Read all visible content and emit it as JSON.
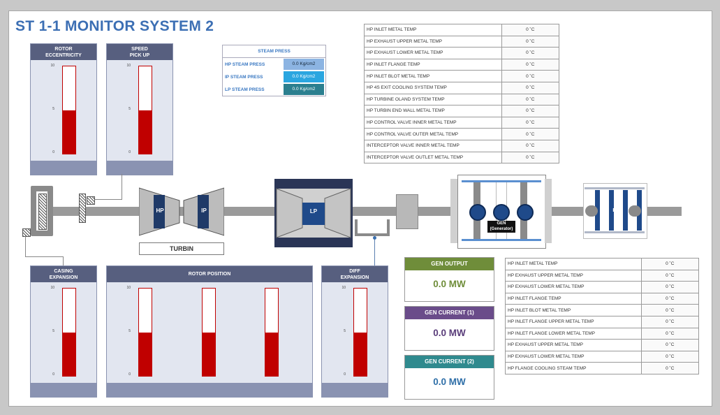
{
  "title": "ST 1-1 MONITOR SYSTEM 2",
  "colors": {
    "accent": "#3c6fb4",
    "panel_header": "#575f7f",
    "gauge_red": "#c00000",
    "gen_output": "#6f8d3a",
    "gen_current1": "#6a4c8a",
    "gen_current2": "#2f8a8e"
  },
  "gauges": {
    "rotor_eccentricity": {
      "title_line1": "ROTOR",
      "title_line2": "ECCENTRICITY",
      "ticks": [
        "10",
        "5",
        "0"
      ],
      "level": 0.5
    },
    "speed_pick_up": {
      "title_line1": "SPEED",
      "title_line2": "PICK UP",
      "ticks": [
        "10",
        "5",
        "0"
      ],
      "level": 0.5
    },
    "casing_expansion": {
      "title_line1": "CASING",
      "title_line2": "EXPANSION",
      "ticks": [
        "10",
        "5",
        "0"
      ],
      "level": 0.5
    },
    "rotor_position": {
      "title": "ROTOR POSITION",
      "ticks": [
        "10",
        "5",
        "0"
      ],
      "levels": [
        0.5,
        0.5,
        0.5
      ]
    },
    "diff_expansion": {
      "title_line1": "DIFF",
      "title_line2": "EXPANSION",
      "ticks": [
        "10",
        "5",
        "0"
      ],
      "level": 0.5
    }
  },
  "steam_press": {
    "title": "STEAM PRESS",
    "rows": [
      {
        "label": "HP STEAM PRESS",
        "value": "0.0 Kg/cm2",
        "color": "#8cb4e2"
      },
      {
        "label": "IP STEAM PRESS",
        "value": "0.0 Kg/cm2",
        "color": "#2aa6e0"
      },
      {
        "label": "LP STEAM PRESS",
        "value": "0.0 Kg/cm2",
        "color": "#2b7f8f"
      }
    ]
  },
  "temp_table_top": [
    {
      "label": "HP INLET METAL TEMP",
      "value": "0 ˚C"
    },
    {
      "label": "HP EXHAUST UPPER METAL TEMP",
      "value": "0 ˚C"
    },
    {
      "label": "HP EXHAUST LOWER METAL TEMP",
      "value": "0 ˚C"
    },
    {
      "label": "HP INLET FLANGE TEMP",
      "value": "0 ˚C"
    },
    {
      "label": "HP INLET BLOT METAL TEMP",
      "value": "0 ˚C"
    },
    {
      "label": "HP 4S EXIT COOLING SYSTEM TEMP",
      "value": "0 ˚C"
    },
    {
      "label": "HP TURBINE OLAND SYSTEM TEMP",
      "value": "0 ˚C"
    },
    {
      "label": "HP TURBIN END WALL METAL TEMP",
      "value": "0 ˚C"
    },
    {
      "label": " HP CONTROL VALVE INNER METAL TEMP",
      "value": "0 ˚C"
    },
    {
      "label": "HP CONTROL VALVE OUTER METAL TEMP",
      "value": "0 ˚C"
    },
    {
      "label": "INTERCEPTOR VALVE INNER METAL TEMP",
      "value": "0 ˚C"
    },
    {
      "label": "INTERCEPTOR VALVE OUTLET METAL TEMP",
      "value": "0 ˚C"
    }
  ],
  "temp_table_bottom": [
    {
      "label": "HP INLET METAL TEMP",
      "value": "0 ˚C"
    },
    {
      "label": "HP EXHAUST UPPER METAL TEMP",
      "value": "0 ˚C"
    },
    {
      "label": "HP EXHAUST LOWER METAL TEMP",
      "value": "0 ˚C"
    },
    {
      "label": "HP INLET FLANGE TEMP",
      "value": "0 ˚C"
    },
    {
      "label": "HP INLET BLOT METAL TEMP",
      "value": "0 ˚C"
    },
    {
      "label": "HP INLET FLANGE UPPER METAL TEMP",
      "value": "0 ˚C"
    },
    {
      "label": "HP INLET FLANGE LOWER METAL TEMP",
      "value": "0 ˚C"
    },
    {
      "label": "HP EXHAUST UPPER METAL TEMP",
      "value": "0 ˚C"
    },
    {
      "label": " HP EXHAUST LOWER METAL TEMP",
      "value": "0 ˚C"
    },
    {
      "label": "HP FLANGE COOLING STEAM TEMP",
      "value": "0 ˚C"
    }
  ],
  "gen": {
    "output": {
      "label": "GEN OUTPUT",
      "value": "0.0 MW"
    },
    "current1": {
      "label": "GEN CURRENT (1)",
      "value": "0.0 MW"
    },
    "current2": {
      "label": "GEN CURRENT (2)",
      "value": "0.0 MW"
    }
  },
  "machinery": {
    "hp_label": "HP",
    "ip_label": "IP",
    "lp_label": "LP",
    "turbin_label": "TURBIN",
    "gen_label_line1": "GEN",
    "gen_label_line2": "(Generator)",
    "ex_label": "EX"
  }
}
